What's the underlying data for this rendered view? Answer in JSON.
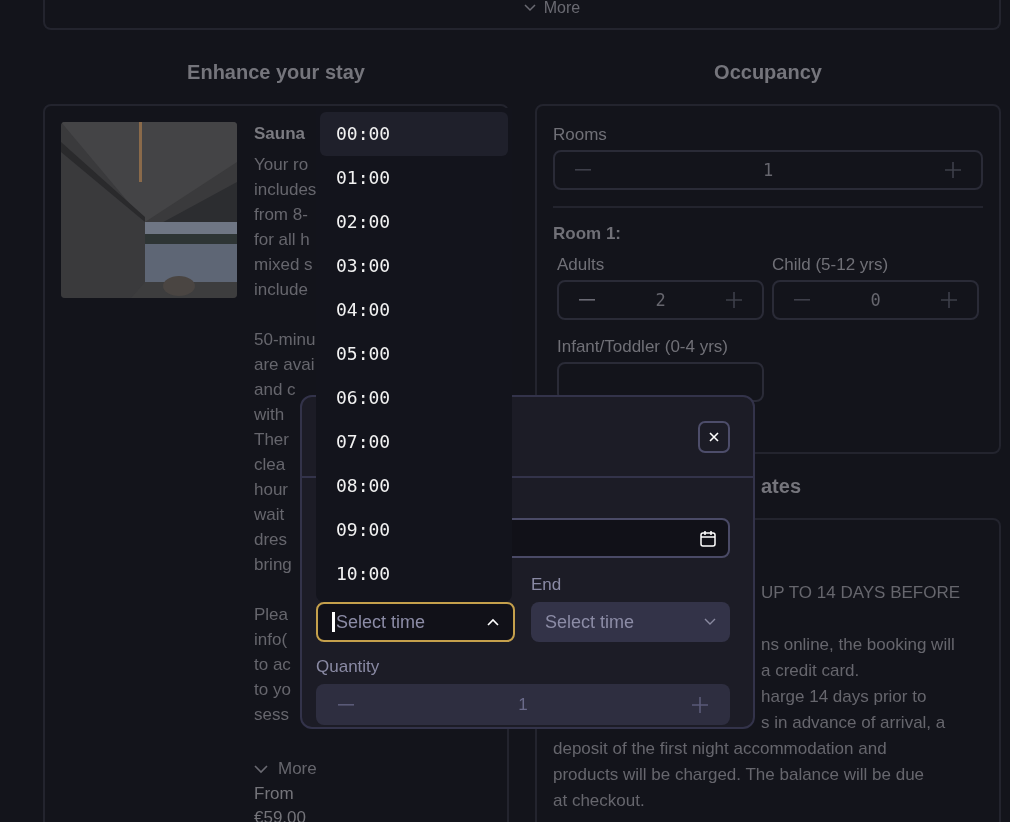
{
  "top_card": {
    "more_label": "More"
  },
  "enhance": {
    "heading": "Enhance your stay",
    "name": "Sauna",
    "paragraphs": [
      [
        "Your ro",
        "includes",
        "from 8-",
        "for all h",
        "mixed s",
        "include"
      ],
      [
        "50-minu",
        "are avai",
        "and c",
        "with",
        "Ther",
        "clea",
        "hour",
        "wait",
        "dres",
        "bring"
      ],
      [
        "Plea",
        "info(",
        "to ac",
        "to yo",
        "sess"
      ]
    ],
    "more_label": "More",
    "from_label": "From",
    "price": "€59.00"
  },
  "occupancy": {
    "heading": "Occupancy",
    "rooms": {
      "label": "Rooms",
      "value": "1"
    },
    "room_title": "Room 1:",
    "guests": [
      {
        "label": "Adults",
        "value": "2"
      },
      {
        "label": "Child (5-12 yrs)",
        "value": "0"
      },
      {
        "label": "Infant/Toddler (0-4 yrs)"
      }
    ]
  },
  "rates": {
    "heading": "ates",
    "paragraphs": [
      [
        {
          "text": "UP TO 14 DAYS BEFORE",
          "kind": "partial"
        }
      ],
      [
        {
          "text": "ns online, the booking will",
          "kind": "partial"
        },
        {
          "text": "a credit card.",
          "kind": "partial"
        },
        {
          "text": "harge 14 days prior to",
          "kind": "partial"
        },
        {
          "text": "s in advance of arrival, a",
          "kind": "partial"
        },
        {
          "text": "deposit of the first night accommodation and",
          "kind": "full"
        },
        {
          "text": "products will be charged. The balance will be due",
          "kind": "full"
        },
        {
          "text": "at checkout.",
          "kind": "full"
        }
      ]
    ]
  },
  "modal": {
    "start": {
      "placeholder": "Select time",
      "open": true
    },
    "end": {
      "label": "End",
      "placeholder": "Select time",
      "open": false
    },
    "quantity": {
      "label": "Quantity",
      "value": "1",
      "disabled": true
    }
  },
  "time_options": [
    {
      "label": "00:00",
      "selected": true
    },
    {
      "label": "01:00",
      "selected": false
    },
    {
      "label": "02:00",
      "selected": false
    },
    {
      "label": "03:00",
      "selected": false
    },
    {
      "label": "04:00",
      "selected": false
    },
    {
      "label": "05:00",
      "selected": false
    },
    {
      "label": "06:00",
      "selected": false
    },
    {
      "label": "07:00",
      "selected": false
    },
    {
      "label": "08:00",
      "selected": false
    },
    {
      "label": "09:00",
      "selected": false
    },
    {
      "label": "10:00",
      "selected": false
    }
  ]
}
